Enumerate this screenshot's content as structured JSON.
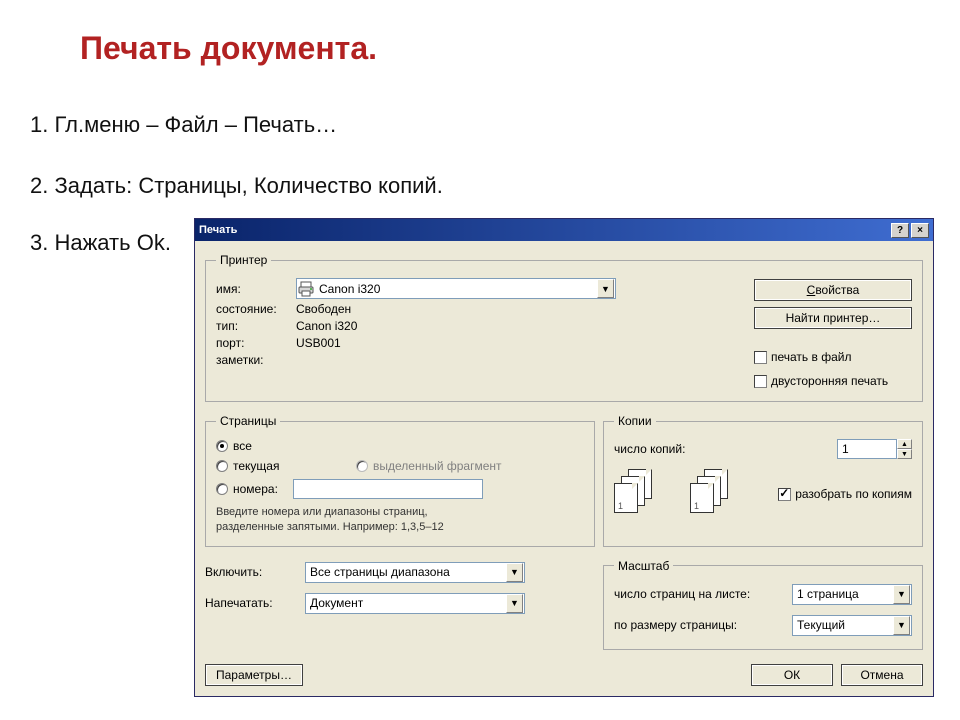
{
  "slide": {
    "title": "Печать документа.",
    "step1": "1. Гл.меню – Файл – Печать…",
    "step2": "2. Задать: Страницы, Количество копий.",
    "step3": "3. Нажать Ok."
  },
  "dialog": {
    "title": "Печать",
    "help_btn": "?",
    "close_btn": "×",
    "printer": {
      "legend": "Принтер",
      "name_label": "имя:",
      "name_value": "Canon i320",
      "status_label": "состояние:",
      "status_value": "Свободен",
      "type_label": "тип:",
      "type_value": "Canon i320",
      "port_label": "порт:",
      "port_value": "USB001",
      "notes_label": "заметки:",
      "properties_btn": "Свойства",
      "properties_underline": "С",
      "find_btn": "Найти принтер…",
      "print_to_file": "печать в файл",
      "duplex": "двусторонняя печать"
    },
    "pages": {
      "legend": "Страницы",
      "all": "все",
      "current": "текущая",
      "selection": "выделенный фрагмент",
      "numbers": "номера:",
      "hint1": "Введите номера или диапазоны страниц,",
      "hint2": "разделенные запятыми. Например: 1,3,5–12"
    },
    "copies": {
      "legend": "Копии",
      "count_label": "число копий:",
      "count_value": "1",
      "collate": "разобрать по копиям"
    },
    "include_label": "Включить:",
    "include_value": "Все страницы диапазона",
    "print_label": "Напечатать:",
    "print_value": "Документ",
    "scale": {
      "legend": "Масштаб",
      "pages_per_label": "число страниц на листе:",
      "pages_per_value": "1 страница",
      "fit_label": "по размеру страницы:",
      "fit_value": "Текущий"
    },
    "params_btn": "Параметры…",
    "ok_btn": "ОК",
    "cancel_btn": "Отмена"
  }
}
